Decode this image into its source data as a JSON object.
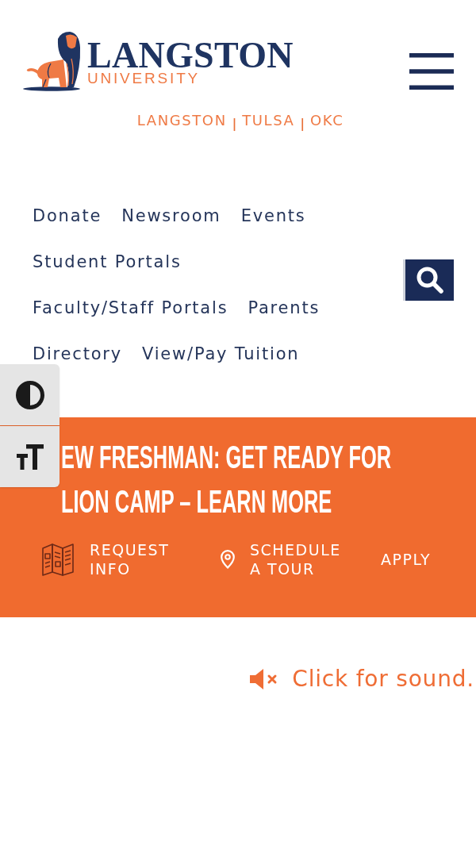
{
  "header": {
    "logo": {
      "wordmark": "LANGSTON",
      "subtitle": "UNIVERSITY"
    }
  },
  "campuses": {
    "items": [
      {
        "kind": "link",
        "text": "LANGSTON"
      },
      {
        "kind": "separator",
        "text": "|"
      },
      {
        "kind": "link",
        "text": "TULSA"
      },
      {
        "kind": "separator",
        "text": "|"
      },
      {
        "kind": "link",
        "text": "OKC"
      }
    ]
  },
  "utility_nav": {
    "rows": [
      {
        "links": [
          "Donate",
          "Newsroom",
          "Events"
        ]
      },
      {
        "links": [
          "Student Portals"
        ]
      },
      {
        "links": [
          "Faculty/Staff Portals",
          "Parents"
        ]
      },
      {
        "links": [
          "Directory",
          "View/Pay Tuition"
        ]
      }
    ]
  },
  "accessibility_toolbar": {
    "tools": [
      {
        "kind": "contrast"
      },
      {
        "kind": "text_size"
      }
    ]
  },
  "banner": {
    "headline": "EW FRESHMAN: GET READY FOR LION CAMP – LEARN MORE",
    "actions": [
      {
        "kind": "map",
        "label": "REQUEST INFO"
      },
      {
        "kind": "pin",
        "label": "SCHEDULE A TOUR"
      },
      {
        "kind": "text",
        "label": "APPLY"
      }
    ]
  },
  "sound_prompt": {
    "label": "Click for sound.",
    "muted": true
  }
}
